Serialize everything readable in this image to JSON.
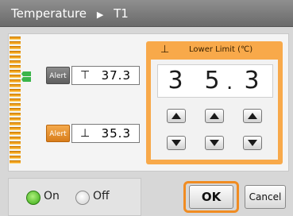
{
  "titlebar": {
    "title": "Temperature",
    "separator": "▶",
    "channel": "T1"
  },
  "meter": {
    "color": "#f0a020",
    "segments": 27,
    "upper_alarm_marker": "green-arrow",
    "lower_alarm_marker": "green-arrow"
  },
  "upper_alert": {
    "button_label": "Alert",
    "symbol": "⊤",
    "value": "37.3"
  },
  "lower_alert": {
    "button_label": "Alert",
    "symbol": "⊥",
    "value": "35.3"
  },
  "editor": {
    "icon": "lower-limit-arrow-icon",
    "arrow": "⊥",
    "title": "Lower Limit (℃)",
    "digits": [
      "3",
      "5",
      "3"
    ],
    "decimal": ".",
    "accent": "#f8a94a"
  },
  "power": {
    "on_label": "On",
    "off_label": "Off",
    "selected": "On"
  },
  "actions": {
    "ok_label": "OK",
    "cancel_label": "Cancel"
  }
}
